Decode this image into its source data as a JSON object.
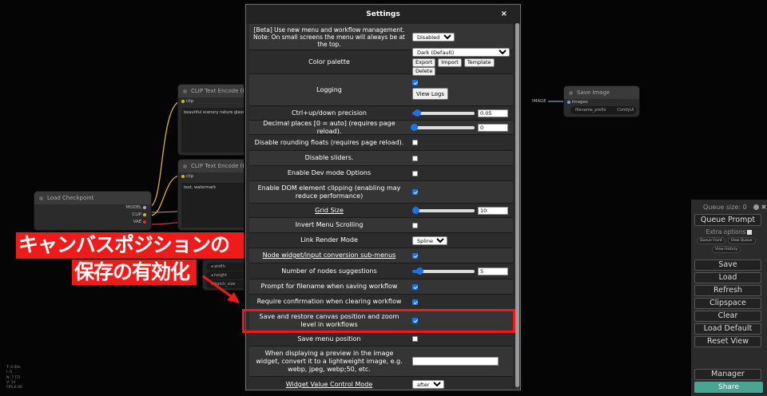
{
  "canvas": {
    "nodes": {
      "clip1": {
        "title": "CLIP Text Encode (Prom",
        "port": "clip",
        "text": "beautiful scenery nature glass bottl"
      },
      "clip2": {
        "title": "CLIP Text Encode (Prom",
        "port": "clip",
        "text": "text, watermark"
      },
      "checkpoint": {
        "title": "Load Checkpoint",
        "outputs": [
          "MODEL",
          "CLIP",
          "VAE"
        ]
      },
      "save": {
        "title": "Save Image",
        "input": "images",
        "widget_label": "filename_prefix",
        "widget_value": "ComfyUI",
        "incoming": "IMAGE"
      },
      "latent_widgets": [
        "width",
        "height",
        "batch_size"
      ]
    },
    "stats": [
      "T: 0.00s",
      "I: 0",
      "N: 7 [7]",
      "V: 14",
      "FPS:0.00"
    ]
  },
  "annotation": {
    "line1": "キャンバスポジションの",
    "line2": "保存の有効化"
  },
  "settings": {
    "title": "Settings",
    "close": "×",
    "beta": {
      "label": "[Beta] Use new menu and workflow management. Note: On small screens the menu will always be at the top.",
      "value": "Disabled"
    },
    "palette": {
      "label": "Color palette",
      "value": "Dark (Default)",
      "buttons": [
        "Export",
        "Import",
        "Template",
        "Delete"
      ]
    },
    "logging": {
      "label": "Logging",
      "button": "View Logs"
    },
    "ctrl_precision": {
      "label": "Ctrl+up/down precision",
      "value": "0.05"
    },
    "decimal_places": {
      "label": "Decimal places [0 = auto] (requires page reload).",
      "value": "0"
    },
    "disable_rounding": {
      "label": "Disable rounding floats (requires page reload)."
    },
    "disable_sliders": {
      "label": "Disable sliders."
    },
    "dev_mode": {
      "label": "Enable Dev mode Options"
    },
    "dom_clipping": {
      "label": "Enable DOM element clipping (enabling may reduce performance)"
    },
    "grid_size": {
      "label": "Grid Size",
      "value": "10"
    },
    "invert_scroll": {
      "label": "Invert Menu Scrolling"
    },
    "link_render": {
      "label": "Link Render Mode",
      "value": "Spline"
    },
    "widget_conversion": {
      "label": "Node widget/input conversion sub-menus"
    },
    "node_suggestions": {
      "label": "Number of nodes suggestions",
      "value": "5"
    },
    "prompt_filename": {
      "label": "Prompt for filename when saving workflow"
    },
    "confirm_clear": {
      "label": "Require confirmation when clearing workflow"
    },
    "save_canvas": {
      "label": "Save and restore canvas position and zoom level in workflows"
    },
    "save_menu": {
      "label": "Save menu position"
    },
    "preview_convert": {
      "label": "When displaying a preview in the image widget, convert it to a lightweight image, e.g. webp, jpeg, webp;50, etc."
    },
    "widget_control": {
      "label": "Widget Value Control Mode",
      "value": "after"
    }
  },
  "menu": {
    "queue_size": "Queue size: 0",
    "queue_prompt": "Queue Prompt",
    "extra_options": "Extra options",
    "queue_front": "Queue Front",
    "view_queue": "View Queue",
    "view_history": "View History",
    "buttons": [
      "Save",
      "Load",
      "Refresh",
      "Clipspace",
      "Clear",
      "Load Default",
      "Reset View"
    ],
    "manager": "Manager",
    "share": "Share"
  },
  "colors": {
    "accent": "#1a73e8",
    "highlight": "#ef1b1b",
    "share": "#4aa590"
  }
}
